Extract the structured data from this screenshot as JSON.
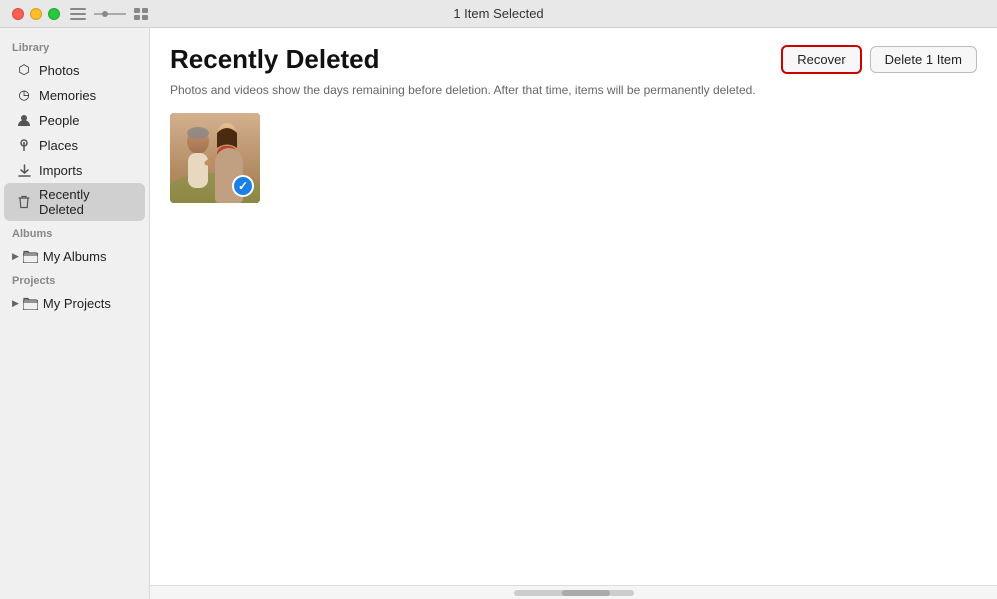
{
  "titlebar": {
    "title": "1 Item Selected",
    "buttons": {
      "close": "close",
      "minimize": "minimize",
      "maximize": "maximize"
    }
  },
  "sidebar": {
    "library_label": "Library",
    "albums_label": "Albums",
    "projects_label": "Projects",
    "items": [
      {
        "id": "photos",
        "label": "Photos",
        "icon": "photos-icon",
        "active": false
      },
      {
        "id": "memories",
        "label": "Memories",
        "icon": "memories-icon",
        "active": false
      },
      {
        "id": "people",
        "label": "People",
        "icon": "people-icon",
        "active": false
      },
      {
        "id": "places",
        "label": "Places",
        "icon": "places-icon",
        "active": false
      },
      {
        "id": "imports",
        "label": "Imports",
        "icon": "imports-icon",
        "active": false
      },
      {
        "id": "recently-deleted",
        "label": "Recently Deleted",
        "icon": "trash-icon",
        "active": true
      }
    ],
    "albums_group": {
      "label": "My Albums",
      "icon": "folder-icon"
    },
    "projects_group": {
      "label": "My Projects",
      "icon": "folder-icon"
    }
  },
  "main": {
    "title": "Recently Deleted",
    "description": "Photos and videos show the days remaining before deletion. After that time, items will be permanently deleted.",
    "recover_button": "Recover",
    "delete_button": "Delete 1 Item"
  },
  "photos": [
    {
      "id": "photo-1",
      "selected": true,
      "alt": "Two people smiling outdoors"
    }
  ]
}
